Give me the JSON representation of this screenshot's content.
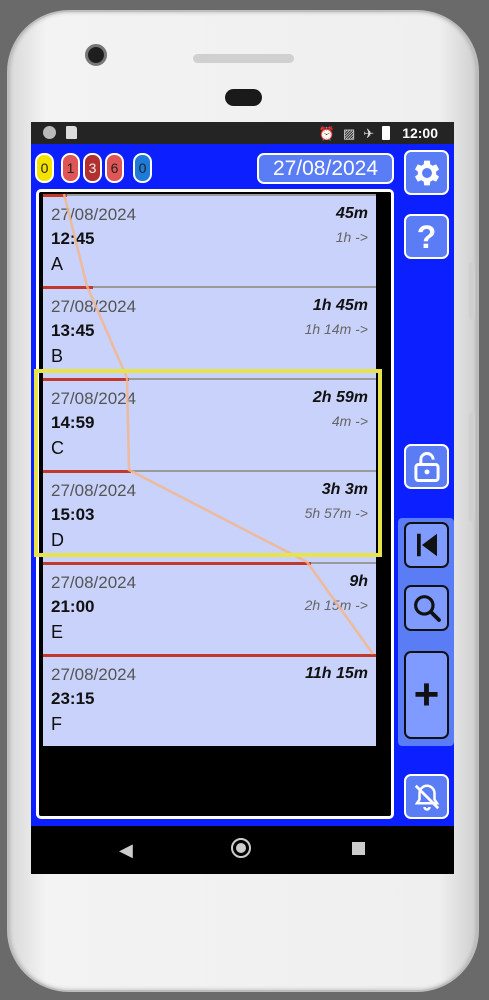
{
  "status_bar": {
    "time": "12:00"
  },
  "badges": [
    {
      "value": "0",
      "color": "#f5e200",
      "text_color": "#222"
    },
    {
      "value": "1",
      "color": "#e05656",
      "text_color": "#222"
    },
    {
      "value": "3",
      "color": "#b23030",
      "text_color": "#eee"
    },
    {
      "value": "6",
      "color": "#e05656",
      "text_color": "#222"
    },
    {
      "value": "0",
      "color": "#1e7bd8",
      "text_color": "#222"
    }
  ],
  "header": {
    "date": "27/08/2024"
  },
  "entries": [
    {
      "date": "27/08/2024",
      "time": "12:45",
      "name": "A",
      "duration": "45m",
      "gap": "1h  ->"
    },
    {
      "date": "27/08/2024",
      "time": "13:45",
      "name": "B",
      "duration": "1h 45m",
      "gap": "1h 14m ->"
    },
    {
      "date": "27/08/2024",
      "time": "14:59",
      "name": "C",
      "duration": "2h 59m",
      "gap": "4m ->"
    },
    {
      "date": "27/08/2024",
      "time": "15:03",
      "name": "D",
      "duration": "3h 3m",
      "gap": "5h 57m ->"
    },
    {
      "date": "27/08/2024",
      "time": "21:00",
      "name": "E",
      "duration": "9h",
      "gap": "2h 15m ->"
    },
    {
      "date": "27/08/2024",
      "time": "23:15",
      "name": "F",
      "duration": "11h 15m",
      "gap": ""
    }
  ],
  "icons": {
    "settings": "gear-icon",
    "help": "help-icon",
    "lock": "lock-icon",
    "first": "skip-to-first-icon",
    "search": "search-icon",
    "add": "plus-icon",
    "notifications": "bell-off-icon"
  },
  "colors": {
    "background": "#0b1fff",
    "panel": "#5a7df5",
    "row": "#c9d2fb",
    "highlight": "#e7e34a"
  }
}
